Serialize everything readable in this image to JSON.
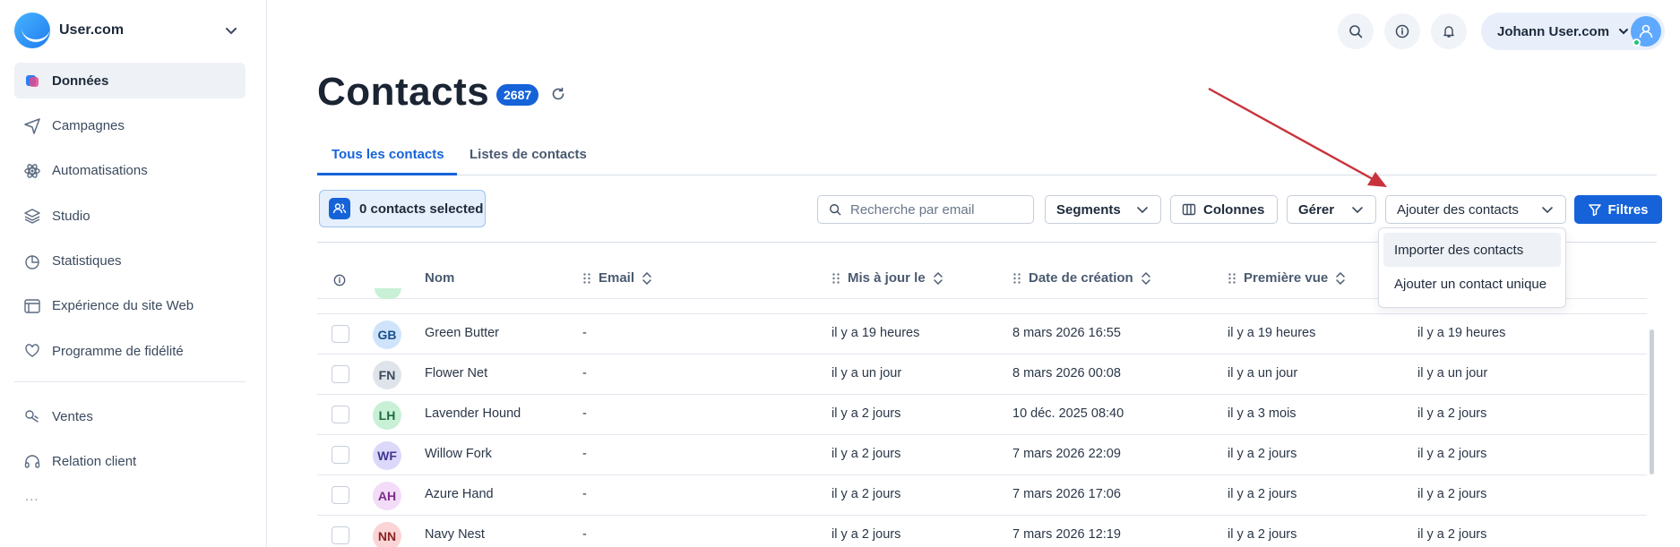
{
  "brand": {
    "name": "User.com"
  },
  "sidebar": {
    "items": [
      {
        "label": "Données",
        "icon": "database-icon",
        "active": true
      },
      {
        "label": "Campagnes",
        "icon": "paper-plane-icon"
      },
      {
        "label": "Automatisations",
        "icon": "atom-icon"
      },
      {
        "label": "Studio",
        "icon": "layers-icon"
      },
      {
        "label": "Statistiques",
        "icon": "pie-chart-icon"
      },
      {
        "label": "Expérience du site Web",
        "icon": "browser-window-icon"
      },
      {
        "label": "Programme de fidélité",
        "icon": "heart-hand-icon"
      }
    ],
    "items2": [
      {
        "label": "Ventes",
        "icon": "sales-icon"
      },
      {
        "label": "Relation client",
        "icon": "headset-icon"
      }
    ],
    "more": "..."
  },
  "topbar": {
    "user_name": "Johann User.com"
  },
  "header": {
    "title": "Contacts",
    "count": "2687"
  },
  "tabs": [
    {
      "label": "Tous les contacts",
      "active": true
    },
    {
      "label": "Listes de contacts",
      "active": false
    }
  ],
  "toolbar": {
    "selected": "0 contacts selected",
    "search_placeholder": "Recherche par email",
    "segments": "Segments",
    "columns": "Colonnes",
    "manage": "Gérer",
    "add_contacts": "Ajouter des contacts",
    "filters": "Filtres"
  },
  "dropdown": {
    "items": [
      "Importer des contacts",
      "Ajouter un contact unique"
    ]
  },
  "table": {
    "headers": {
      "name": "Nom",
      "email": "Email",
      "updated": "Mis à jour le",
      "created": "Date de création",
      "first_seen": "Première vue"
    },
    "rows": [
      {
        "initials": "GB",
        "name": "Green Butter",
        "email": "-",
        "updated": "il y a 19 heures",
        "created": "8 mars 2026 16:55",
        "first_seen": "il y a 19 heures",
        "last_seen": "il y a 19 heures",
        "avatar_bg": "#cfe4fb",
        "avatar_fg": "#1a4f8c"
      },
      {
        "initials": "FN",
        "name": "Flower Net",
        "email": "-",
        "updated": "il y a un jour",
        "created": "8 mars 2026 00:08",
        "first_seen": "il y a un jour",
        "last_seen": "il y a un jour",
        "avatar_bg": "#dfe4ea",
        "avatar_fg": "#3c4a5c"
      },
      {
        "initials": "LH",
        "name": "Lavender Hound",
        "email": "-",
        "updated": "il y a 2 jours",
        "created": "10 déc. 2025 08:40",
        "first_seen": "il y a 3 mois",
        "last_seen": "il y a 2 jours",
        "avatar_bg": "#c8f0d6",
        "avatar_fg": "#1f6b3e"
      },
      {
        "initials": "WF",
        "name": "Willow Fork",
        "email": "-",
        "updated": "il y a 2 jours",
        "created": "7 mars 2026 22:09",
        "first_seen": "il y a 2 jours",
        "last_seen": "il y a 2 jours",
        "avatar_bg": "#dcd8fa",
        "avatar_fg": "#3f3690"
      },
      {
        "initials": "AH",
        "name": "Azure Hand",
        "email": "-",
        "updated": "il y a 2 jours",
        "created": "7 mars 2026 17:06",
        "first_seen": "il y a 2 jours",
        "last_seen": "il y a 2 jours",
        "avatar_bg": "#f3dcf7",
        "avatar_fg": "#7a2d8a"
      },
      {
        "initials": "NN",
        "name": "Navy Nest",
        "email": "-",
        "updated": "il y a 2 jours",
        "created": "7 mars 2026 12:19",
        "first_seen": "il y a 2 jours",
        "last_seen": "il y a 2 jours",
        "avatar_bg": "#fbd5d5",
        "avatar_fg": "#8c2424"
      }
    ]
  },
  "colors": {
    "accent": "#1663d9",
    "annotation_arrow": "#c8333b"
  }
}
